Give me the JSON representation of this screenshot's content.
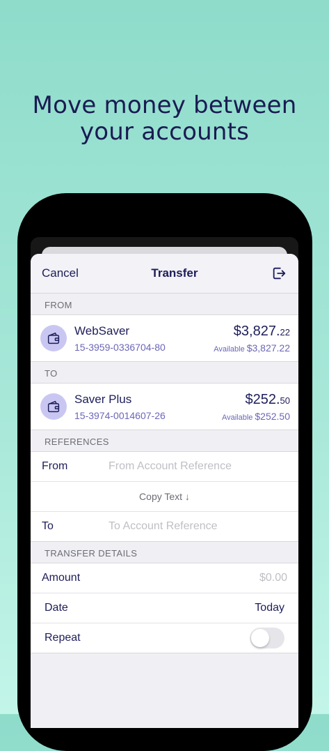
{
  "headline": {
    "line1": "Move money between",
    "line2": "your accounts"
  },
  "nav": {
    "cancel": "Cancel",
    "title": "Transfer"
  },
  "from": {
    "header": "FROM",
    "account": {
      "name": "WebSaver",
      "number": "15-3959-0336704-80",
      "balance_main": "$3,827.",
      "balance_cents": "22",
      "available_label": "Available",
      "available_value": "$3,827.22"
    }
  },
  "to": {
    "header": "TO",
    "account": {
      "name": "Saver Plus",
      "number": "15-3974-0014607-26",
      "balance_main": "$252.",
      "balance_cents": "50",
      "available_label": "Available",
      "available_value": "$252.50"
    }
  },
  "references": {
    "header": "REFERENCES",
    "from_label": "From",
    "from_placeholder": "From Account Reference",
    "copy_text": "Copy Text ↓",
    "to_label": "To",
    "to_placeholder": "To Account Reference"
  },
  "details": {
    "header": "TRANSFER DETAILS",
    "amount_label": "Amount",
    "amount_placeholder": "$0.00",
    "date_label": "Date",
    "date_value": "Today",
    "repeat_label": "Repeat",
    "repeat_on": false
  },
  "colors": {
    "accent": "#1d1d5a",
    "link": "#6b66b8",
    "icon_bg": "#c9c7f2"
  }
}
